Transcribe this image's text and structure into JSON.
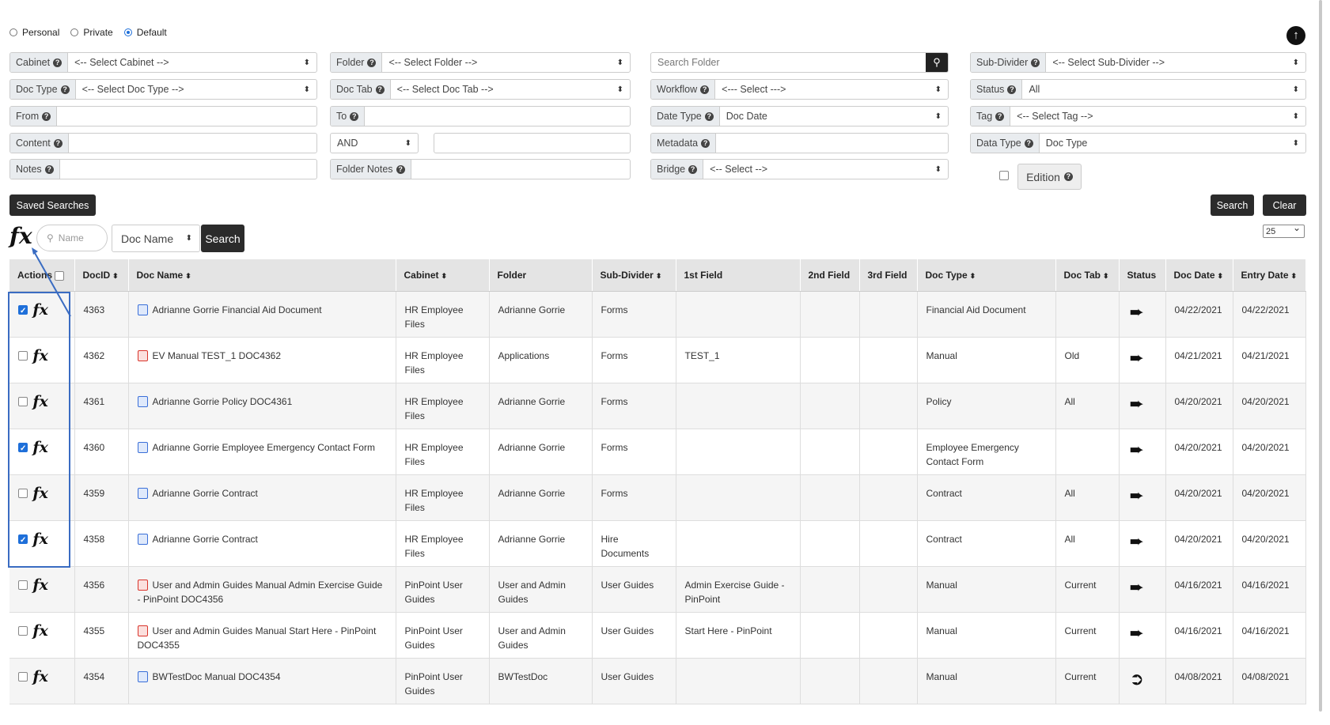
{
  "scope": {
    "options": [
      "Personal",
      "Private",
      "Default"
    ],
    "selected": "Default"
  },
  "filters": {
    "cabinet": {
      "label": "Cabinet",
      "value": "<-- Select Cabinet -->"
    },
    "folder": {
      "label": "Folder",
      "value": "<-- Select Folder -->"
    },
    "search_folder": {
      "placeholder": "Search Folder"
    },
    "sub_divider": {
      "label": "Sub-Divider",
      "value": "<-- Select Sub-Divider -->"
    },
    "doc_type": {
      "label": "Doc Type",
      "value": "<-- Select Doc Type -->"
    },
    "doc_tab": {
      "label": "Doc Tab",
      "value": "<-- Select Doc Tab -->"
    },
    "workflow": {
      "label": "Workflow",
      "value": "<--- Select --->"
    },
    "status": {
      "label": "Status",
      "value": "All"
    },
    "from": {
      "label": "From",
      "value": ""
    },
    "to": {
      "label": "To",
      "value": ""
    },
    "date_type": {
      "label": "Date Type",
      "value": "Doc Date"
    },
    "tag": {
      "label": "Tag",
      "value": "<-- Select Tag -->"
    },
    "content": {
      "label": "Content",
      "value": ""
    },
    "operator": {
      "value": "AND"
    },
    "metadata": {
      "label": "Metadata",
      "value": ""
    },
    "data_type": {
      "label": "Data Type",
      "value": "Doc Type"
    },
    "notes": {
      "label": "Notes",
      "value": ""
    },
    "folder_notes": {
      "label": "Folder Notes",
      "value": ""
    },
    "bridge": {
      "label": "Bridge",
      "value": "<-- Select -->"
    },
    "edition": {
      "label": "Edition",
      "checked": false
    }
  },
  "buttons": {
    "saved_searches": "Saved Searches",
    "search": "Search",
    "clear": "Clear"
  },
  "quick_search": {
    "fx_label": "fx",
    "name_placeholder": "Name",
    "field": "Doc Name",
    "button": "Search"
  },
  "page_size": "25",
  "table": {
    "columns": [
      "Actions",
      "DocID",
      "Doc Name",
      "Cabinet",
      "Folder",
      "Sub-Divider",
      "1st Field",
      "2nd Field",
      "3rd Field",
      "Doc Type",
      "Doc Tab",
      "Status",
      "Doc Date",
      "Entry Date"
    ],
    "rows": [
      {
        "checked": true,
        "id": "4363",
        "icon": "word",
        "name": "Adrianne Gorrie Financial Aid Document",
        "cabinet": "HR Employee Files",
        "folder": "Adrianne Gorrie",
        "sub": "Forms",
        "f1": "",
        "f2": "",
        "f3": "",
        "type": "Financial Aid Document",
        "tab": "",
        "status": "check-in-icon",
        "doc_date": "04/22/2021",
        "entry_date": "04/22/2021"
      },
      {
        "checked": false,
        "id": "4362",
        "icon": "pdf",
        "name": "EV Manual TEST_1 DOC4362",
        "cabinet": "HR Employee Files",
        "folder": "Applications",
        "sub": "Forms",
        "f1": "TEST_1",
        "f2": "",
        "f3": "",
        "type": "Manual",
        "tab": "Old",
        "status": "check-in-icon",
        "doc_date": "04/21/2021",
        "entry_date": "04/21/2021"
      },
      {
        "checked": false,
        "id": "4361",
        "icon": "word",
        "name": "Adrianne Gorrie Policy DOC4361",
        "cabinet": "HR Employee Files",
        "folder": "Adrianne Gorrie",
        "sub": "Forms",
        "f1": "",
        "f2": "",
        "f3": "",
        "type": "Policy",
        "tab": "All",
        "status": "check-in-icon",
        "doc_date": "04/20/2021",
        "entry_date": "04/20/2021"
      },
      {
        "checked": true,
        "id": "4360",
        "icon": "word",
        "name": "Adrianne Gorrie Employee Emergency Contact Form",
        "cabinet": "HR Employee Files",
        "folder": "Adrianne Gorrie",
        "sub": "Forms",
        "f1": "",
        "f2": "",
        "f3": "",
        "type": "Employee Emergency Contact Form",
        "tab": "",
        "status": "check-in-icon",
        "doc_date": "04/20/2021",
        "entry_date": "04/20/2021"
      },
      {
        "checked": false,
        "id": "4359",
        "icon": "word",
        "name": "Adrianne Gorrie Contract",
        "cabinet": "HR Employee Files",
        "folder": "Adrianne Gorrie",
        "sub": "Forms",
        "f1": "",
        "f2": "",
        "f3": "",
        "type": "Contract",
        "tab": "All",
        "status": "check-in-icon",
        "doc_date": "04/20/2021",
        "entry_date": "04/20/2021"
      },
      {
        "checked": true,
        "id": "4358",
        "icon": "word",
        "name": "Adrianne Gorrie Contract",
        "cabinet": "HR Employee Files",
        "folder": "Adrianne Gorrie",
        "sub": "Hire Documents",
        "f1": "",
        "f2": "",
        "f3": "",
        "type": "Contract",
        "tab": "All",
        "status": "check-in-icon",
        "doc_date": "04/20/2021",
        "entry_date": "04/20/2021"
      },
      {
        "checked": false,
        "id": "4356",
        "icon": "pdf",
        "name": "User and Admin Guides Manual Admin Exercise Guide - PinPoint DOC4356",
        "cabinet": "PinPoint User Guides",
        "folder": "User and Admin Guides",
        "sub": "User Guides",
        "f1": "Admin Exercise Guide - PinPoint",
        "f2": "",
        "f3": "",
        "type": "Manual",
        "tab": "Current",
        "status": "check-in-icon",
        "doc_date": "04/16/2021",
        "entry_date": "04/16/2021"
      },
      {
        "checked": false,
        "id": "4355",
        "icon": "pdf",
        "name": "User and Admin Guides Manual Start Here - PinPoint DOC4355",
        "cabinet": "PinPoint User Guides",
        "folder": "User and Admin Guides",
        "sub": "User Guides",
        "f1": "Start Here - PinPoint",
        "f2": "",
        "f3": "",
        "type": "Manual",
        "tab": "Current",
        "status": "check-in-icon",
        "doc_date": "04/16/2021",
        "entry_date": "04/16/2021"
      },
      {
        "checked": false,
        "id": "4354",
        "icon": "word",
        "name": "BWTestDoc Manual DOC4354",
        "cabinet": "PinPoint User Guides",
        "folder": "BWTestDoc",
        "sub": "User Guides",
        "f1": "",
        "f2": "",
        "f3": "",
        "type": "Manual",
        "tab": "Current",
        "status": "check-out-icon",
        "doc_date": "04/08/2021",
        "entry_date": "04/08/2021"
      }
    ]
  }
}
